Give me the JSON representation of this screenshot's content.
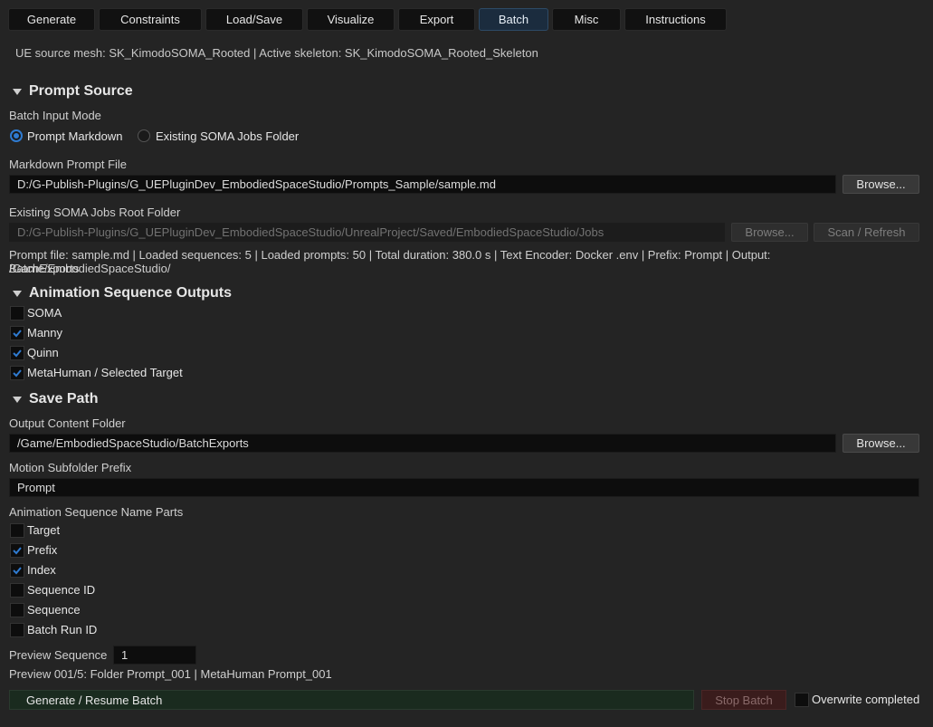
{
  "tabs": [
    {
      "label": "Generate"
    },
    {
      "label": "Constraints"
    },
    {
      "label": "Load/Save"
    },
    {
      "label": "Visualize"
    },
    {
      "label": "Export"
    },
    {
      "label": "Batch"
    },
    {
      "label": "Misc"
    },
    {
      "label": "Instructions"
    }
  ],
  "active_tab": "Batch",
  "info_line": "UE source mesh: SK_KimodoSOMA_Rooted | Active skeleton: SK_KimodoSOMA_Rooted_Skeleton",
  "prompt_source": {
    "title": "Prompt Source",
    "mode_label": "Batch Input Mode",
    "mode_options": [
      "Prompt Markdown",
      "Existing SOMA Jobs Folder"
    ],
    "mode_selected": "Prompt Markdown",
    "markdown_label": "Markdown Prompt File",
    "markdown_value": "D:/G-Publish-Plugins/G_UEPluginDev_EmbodiedSpaceStudio/Prompts_Sample/sample.md",
    "browse_label": "Browse...",
    "jobs_label": "Existing SOMA Jobs Root Folder",
    "jobs_value": "D:/G-Publish-Plugins/G_UEPluginDev_EmbodiedSpaceStudio/UnrealProject/Saved/EmbodiedSpaceStudio/Jobs",
    "jobs_browse_label": "Browse...",
    "scan_label": "Scan / Refresh",
    "status_line1": "Prompt file: sample.md | Loaded sequences: 5 | Loaded prompts: 50 | Total duration: 380.0 s | Text Encoder: Docker .env | Prefix: Prompt | Output: /Game/EmbodiedSpaceStudio/",
    "status_line2": "BatchExports"
  },
  "outputs": {
    "title": "Animation Sequence Outputs",
    "items": [
      {
        "label": "SOMA",
        "checked": false
      },
      {
        "label": "Manny",
        "checked": true
      },
      {
        "label": "Quinn",
        "checked": true
      },
      {
        "label": "MetaHuman / Selected Target",
        "checked": true
      }
    ]
  },
  "save_path": {
    "title": "Save Path",
    "folder_label": "Output Content Folder",
    "folder_value": "/Game/EmbodiedSpaceStudio/BatchExports",
    "browse_label": "Browse...",
    "prefix_label": "Motion Subfolder Prefix",
    "prefix_value": "Prompt",
    "parts_label": "Animation Sequence Name Parts",
    "parts": [
      {
        "label": "Target",
        "checked": false
      },
      {
        "label": "Prefix",
        "checked": true
      },
      {
        "label": "Index",
        "checked": true
      },
      {
        "label": "Sequence ID",
        "checked": false
      },
      {
        "label": "Sequence",
        "checked": false
      },
      {
        "label": "Batch Run ID",
        "checked": false
      }
    ],
    "preview_label": "Preview Sequence",
    "preview_value": "1",
    "preview_text": "Preview 001/5: Folder Prompt_001 | MetaHuman Prompt_001"
  },
  "actions": {
    "generate_label": "Generate / Resume Batch",
    "stop_label": "Stop Batch",
    "overwrite_label": "Overwrite completed",
    "overwrite_checked": false
  },
  "colors": {
    "accent": "#2f7bd1",
    "generate_bg": "#1a2b1f",
    "stop_bg": "#3a1c1c"
  }
}
